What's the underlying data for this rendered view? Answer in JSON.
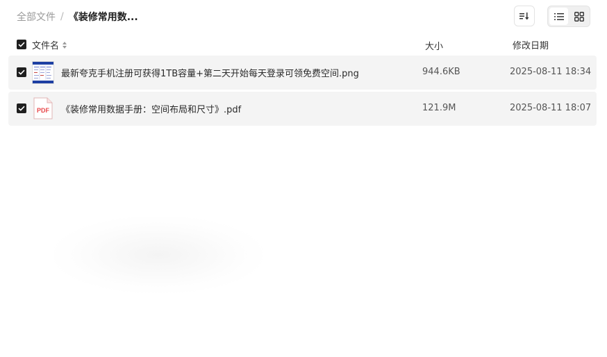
{
  "breadcrumb": {
    "root": "全部文件",
    "separator": "/",
    "current": "《装修常用数..."
  },
  "toolbar": {
    "sort_icon": "sort-icon",
    "list_view_icon": "list-view-icon",
    "grid_view_icon": "grid-view-icon",
    "active_view": "list"
  },
  "table": {
    "headers": {
      "name": "文件名",
      "size": "大小",
      "date": "修改日期"
    },
    "rows": [
      {
        "name": "最新夸克手机注册可获得1TB容量+第二天开始每天登录可领免费空间.png",
        "size": "944.6KB",
        "date": "2025-08-11 18:34",
        "icon": "image-thumbnail-icon",
        "checked": true
      },
      {
        "name": "《装修常用数据手册：空间布局和尺寸》.pdf",
        "size": "121.9M",
        "date": "2025-08-11 18:07",
        "icon": "pdf-file-icon",
        "icon_label": "PDF",
        "checked": true
      }
    ]
  },
  "colors": {
    "row_bg": "#f4f4f4",
    "checkbox": "#1f1f1f",
    "pdf_red": "#e8484b"
  }
}
